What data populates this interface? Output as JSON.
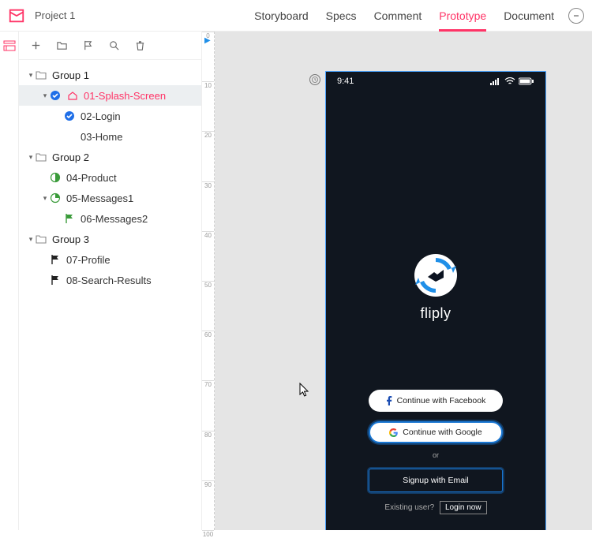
{
  "header": {
    "project_title": "Project 1",
    "tabs": [
      {
        "label": "Storyboard",
        "active": false
      },
      {
        "label": "Specs",
        "active": false
      },
      {
        "label": "Comment",
        "active": false
      },
      {
        "label": "Prototype",
        "active": true
      },
      {
        "label": "Document",
        "active": false
      }
    ]
  },
  "toolbar": {
    "add": "add",
    "folder": "folder",
    "flag": "flag",
    "search": "search",
    "trash": "trash"
  },
  "tree": [
    {
      "type": "group",
      "depth": 0,
      "caret": true,
      "icon": "folder-open",
      "label": "Group 1"
    },
    {
      "type": "item",
      "depth": 1,
      "caret": true,
      "icon": "home",
      "badge": "check-blue",
      "label": "01-Splash-Screen",
      "selected": true
    },
    {
      "type": "item",
      "depth": 2,
      "caret": false,
      "icon": "check-blue",
      "label": "02-Login"
    },
    {
      "type": "item",
      "depth": 2,
      "caret": false,
      "icon": "none",
      "label": "03-Home"
    },
    {
      "type": "group",
      "depth": 0,
      "caret": true,
      "icon": "folder-open",
      "label": "Group 2"
    },
    {
      "type": "item",
      "depth": 1,
      "caret": false,
      "icon": "half-circle-green",
      "label": "04-Product"
    },
    {
      "type": "item",
      "depth": 1,
      "caret": true,
      "icon": "quarter-circle-green",
      "label": "05-Messages1"
    },
    {
      "type": "item",
      "depth": 2,
      "caret": false,
      "icon": "flag-green",
      "label": "06-Messages2"
    },
    {
      "type": "group",
      "depth": 0,
      "caret": true,
      "icon": "folder-open",
      "label": "Group 3"
    },
    {
      "type": "item",
      "depth": 1,
      "caret": false,
      "icon": "flag-black",
      "label": "07-Profile"
    },
    {
      "type": "item",
      "depth": 1,
      "caret": false,
      "icon": "flag-black",
      "label": "08-Search-Results"
    }
  ],
  "ruler": {
    "ticks": [
      0,
      10,
      20,
      30,
      40,
      50,
      60,
      70,
      80,
      90,
      100
    ],
    "marker_at_tick": 0
  },
  "preview": {
    "status_time": "9:41",
    "brand": "fliply",
    "btn_facebook": "Continue with Facebook",
    "btn_google": "Continue with Google",
    "or_text": "or",
    "btn_email": "Signup with Email",
    "existing_text": "Existing user?",
    "login_link": "Login now"
  }
}
